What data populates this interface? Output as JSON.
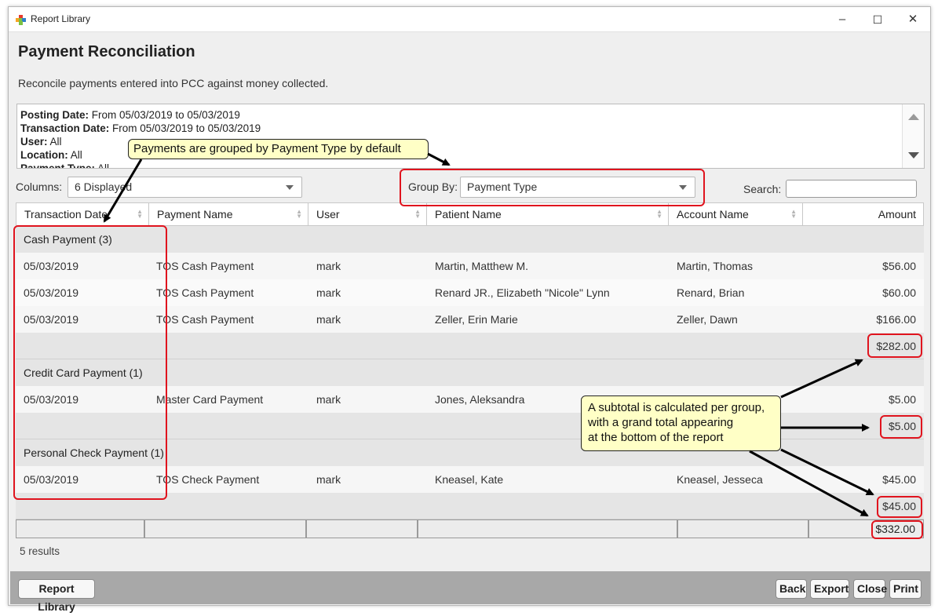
{
  "window": {
    "title": "Report Library",
    "minimize": "–",
    "maximize": "☐",
    "close": "✕"
  },
  "page": {
    "title": "Payment Reconciliation",
    "description": "Reconcile payments entered into PCC against money collected."
  },
  "criteria": [
    {
      "label": "Posting Date:",
      "value": "From 05/03/2019 to 05/03/2019"
    },
    {
      "label": "Transaction Date:",
      "value": "From 05/03/2019 to 05/03/2019"
    },
    {
      "label": "User:",
      "value": "All"
    },
    {
      "label": "Location:",
      "value": "All"
    },
    {
      "label": "Payment Type:",
      "value": "All"
    }
  ],
  "controls": {
    "columns_label": "Columns:",
    "columns_value": "6 Displayed",
    "group_by_label": "Group By:",
    "group_by_value": "Payment Type",
    "search_label": "Search:",
    "search_value": ""
  },
  "table": {
    "columns": [
      "Transaction Date",
      "Payment Name",
      "User",
      "Patient Name",
      "Account Name",
      "Amount"
    ],
    "groups": [
      {
        "label": "Cash Payment (3)",
        "rows": [
          [
            "05/03/2019",
            "TOS Cash Payment",
            "mark",
            "Martin, Matthew M.",
            "Martin, Thomas",
            "$56.00"
          ],
          [
            "05/03/2019",
            "TOS Cash Payment",
            "mark",
            "Renard JR., Elizabeth \"Nicole\" Lynn",
            "Renard, Brian",
            "$60.00"
          ],
          [
            "05/03/2019",
            "TOS Cash Payment",
            "mark",
            "Zeller, Erin Marie",
            "Zeller, Dawn",
            "$166.00"
          ]
        ],
        "subtotal": "$282.00"
      },
      {
        "label": "Credit Card Payment (1)",
        "rows": [
          [
            "05/03/2019",
            "Master Card Payment",
            "mark",
            "Jones, Aleksandra",
            "",
            "$5.00"
          ]
        ],
        "subtotal": "$5.00"
      },
      {
        "label": "Personal Check Payment (1)",
        "rows": [
          [
            "05/03/2019",
            "TOS Check Payment",
            "mark",
            "Kneasel, Kate",
            "Kneasel, Jesseca",
            "$45.00"
          ]
        ],
        "subtotal": "$45.00"
      }
    ],
    "grand_total": "$332.00"
  },
  "result_count": "5 results",
  "buttons": {
    "report_library": "Report Library",
    "back": "Back",
    "export": "Export",
    "close": "Close",
    "print": "Print"
  },
  "annotations": {
    "group_callout": "Payments are grouped by Payment Type by default",
    "subtotal_callout_lines": [
      "A subtotal is calculated per group,",
      "with a grand total appearing",
      "at the bottom of the report"
    ],
    "highlight_color": "#e0141e",
    "callout_color": "#ffffc6"
  },
  "colors": {
    "window_bg": "#efefef",
    "group_row": "#e5e5e5",
    "bottom_bar": "#a8a8a8"
  }
}
